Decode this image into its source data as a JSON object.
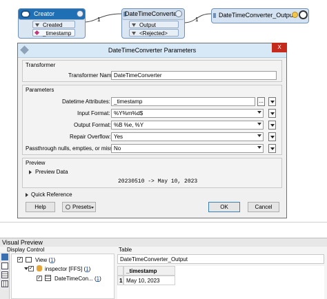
{
  "workflow": {
    "creator": {
      "title": "Creator",
      "port_created": "Created",
      "attr_timestamp": "_timestamp"
    },
    "converter": {
      "title": "DateTimeConverter",
      "port_output": "Output",
      "port_rejected": "<Rejected>"
    },
    "output_node": {
      "title": "DateTimeConverter_Output"
    },
    "link1_count": "1",
    "link2_count": "1"
  },
  "dialog": {
    "title": "DateTimeConverter Parameters",
    "close_label": "X",
    "transformer_section": "Transformer",
    "transformer_name_label": "Transformer Name:",
    "transformer_name_value": "DateTimeConverter",
    "parameters_section": "Parameters",
    "fields": [
      {
        "label": "Datetime Attributes:",
        "value": "_timestamp"
      },
      {
        "label": "Input Format:",
        "value": "%Y%m%d$"
      },
      {
        "label": "Output Format:",
        "value": "%B %e, %Y"
      },
      {
        "label": "Repair Overflow:",
        "value": "Yes"
      },
      {
        "label": "Passthrough nulls, empties, or missing:",
        "value": "No"
      }
    ],
    "browse_label": "...",
    "preview_section": "Preview",
    "preview_data_label": "Preview Data",
    "preview_output": "20230510 -> May 10, 2023",
    "quick_reference": "Quick Reference",
    "help_button": "Help",
    "presets_button": "Presets",
    "ok_button": "OK",
    "cancel_button": "Cancel"
  },
  "visual_preview": {
    "title": "Visual Preview",
    "display_control_label": "Display Control",
    "table_label": "Table",
    "tree": {
      "view": "View",
      "view_count": "1",
      "inspector": "inspector [FFS]",
      "inspector_count": "1",
      "datetime": "DateTimeCon...",
      "datetime_count": "1"
    },
    "table_name": "DateTimeConverter_Output",
    "column_header": "_timestamp",
    "rows": [
      {
        "index": "1",
        "value": "May 10, 2023"
      }
    ]
  },
  "colors": {
    "node_fill": "#dbe6f3",
    "node_border": "#6f8fb4",
    "dialog_title": "#d7e8f7",
    "close_red": "#c42b1c"
  }
}
